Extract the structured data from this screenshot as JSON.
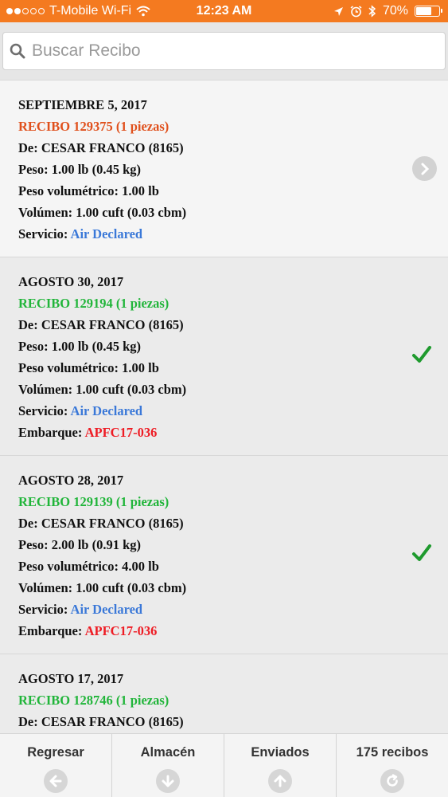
{
  "status_bar": {
    "carrier": "T-Mobile Wi-Fi",
    "time": "12:23 AM",
    "battery_label": "70%",
    "battery_level": 0.7,
    "signal_dots_filled": 2,
    "signal_dots_total": 5
  },
  "search": {
    "placeholder": "Buscar Recibo",
    "value": ""
  },
  "labels": {
    "from": "De: ",
    "weight": "Peso: ",
    "vol_weight": "Peso volumétrico: ",
    "volume": "Volúmen: ",
    "service": "Servicio: ",
    "shipment": "Embarque: "
  },
  "receipts": [
    {
      "date": "SEPTIEMBRE 5, 2017",
      "receipt": "RECIBO 129375 (1 piezas)",
      "from": "CESAR FRANCO (8165)",
      "weight": "1.00 lb (0.45 kg)",
      "vol_weight": "1.00 lb",
      "volume": "1.00 cuft (0.03 cbm)",
      "service": "Air Declared",
      "status_icon": "chevron-right-icon"
    },
    {
      "date": "AGOSTO 30, 2017",
      "receipt": "RECIBO 129194 (1 piezas)",
      "from": "CESAR FRANCO (8165)",
      "weight": "1.00 lb (0.45 kg)",
      "vol_weight": "1.00 lb",
      "volume": "1.00 cuft (0.03 cbm)",
      "service": "Air Declared",
      "shipment": "APFC17-036",
      "status_icon": "checkmark-icon"
    },
    {
      "date": "AGOSTO 28, 2017",
      "receipt": "RECIBO 129139 (1 piezas)",
      "from": "CESAR FRANCO (8165)",
      "weight": "2.00 lb (0.91 kg)",
      "vol_weight": "4.00 lb",
      "volume": "1.00 cuft (0.03 cbm)",
      "service": "Air Declared",
      "shipment": "APFC17-036",
      "status_icon": "checkmark-icon"
    },
    {
      "date": "AGOSTO 17, 2017",
      "receipt": "RECIBO 128746 (1 piezas)",
      "from": "CESAR FRANCO (8165)"
    }
  ],
  "tabs": [
    {
      "label": "Regresar",
      "icon": "arrow-left-icon"
    },
    {
      "label": "Almacén",
      "icon": "arrow-down-icon"
    },
    {
      "label": "Enviados",
      "icon": "arrow-up-icon"
    },
    {
      "label": "175 recibos",
      "icon": "refresh-icon"
    }
  ],
  "colors": {
    "status_bar": "#f47a20",
    "pending_receipt": "#e0501c",
    "shipped_receipt": "#21b53a",
    "service": "#3a78d8",
    "shipment": "#ee1c24",
    "check": "#1f9a2e"
  }
}
